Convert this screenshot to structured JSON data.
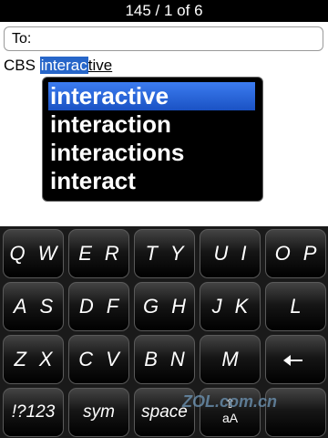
{
  "header": {
    "title": "145 / 1 of 6"
  },
  "to_field": {
    "label": "To:"
  },
  "compose": {
    "prefix": "CBS ",
    "highlighted": "interac",
    "remainder": "tive"
  },
  "suggestions": [
    {
      "text": "interactive",
      "selected": true
    },
    {
      "text": "interaction",
      "selected": false
    },
    {
      "text": "interactions",
      "selected": false
    },
    {
      "text": "interact",
      "selected": false
    }
  ],
  "keyboard": {
    "row1": [
      "QW",
      "ER",
      "TY",
      "UI",
      "OP"
    ],
    "row2": [
      "AS",
      "DF",
      "GH",
      "JK",
      "L"
    ],
    "row3": [
      "ZX",
      "CV",
      "BN",
      "M"
    ],
    "row3_backspace_icon": "backspace-arrow-icon",
    "row4": {
      "symbols": "!?123",
      "sym": "sym",
      "space": "space",
      "case_label": "aA",
      "case_icon": "shift-up-arrow-icon"
    }
  },
  "watermark": "ZOL.com.cn",
  "colors": {
    "selection": "#2766c9",
    "keyboard_bg": "#1a1a1a",
    "key_gradient_top": "#444444"
  }
}
